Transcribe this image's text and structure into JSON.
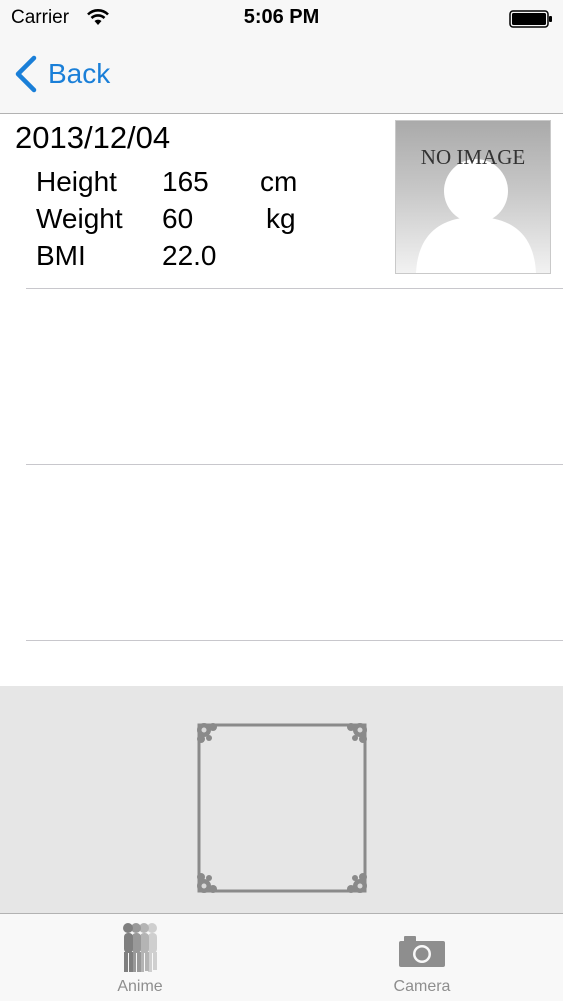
{
  "status_bar": {
    "carrier": "Carrier",
    "time": "5:06 PM"
  },
  "nav": {
    "back_label": "Back"
  },
  "record": {
    "date": "2013/12/04",
    "metrics": [
      {
        "label": "Height",
        "value": "165",
        "unit": "cm"
      },
      {
        "label": "Weight",
        "value": "60",
        "unit": "kg"
      },
      {
        "label": "BMI",
        "value": "22.0",
        "unit": ""
      }
    ],
    "photo_placeholder": "NO IMAGE"
  },
  "tab_bar": {
    "tabs": [
      {
        "label": "Anime",
        "icon": "walking-figures-icon"
      },
      {
        "label": "Camera",
        "icon": "camera-icon"
      }
    ]
  },
  "colors": {
    "accent": "#1a7fd8",
    "tab_inactive": "#8e8e8e",
    "frame_area": "#e6e6e6"
  }
}
